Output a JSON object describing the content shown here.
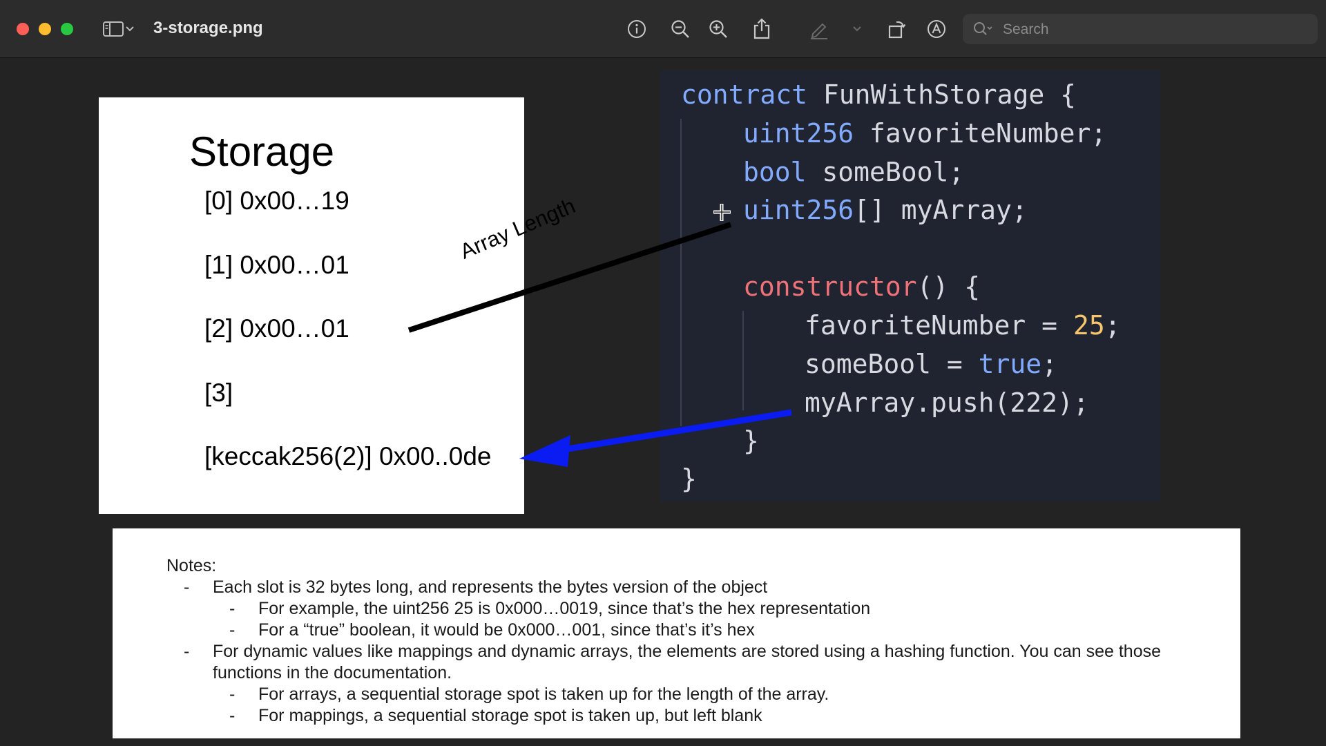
{
  "window": {
    "title": "3-storage.png",
    "search": {
      "placeholder": "Search",
      "value": ""
    },
    "toolbar_icons": [
      "sidebar-toggle-icon",
      "chevron-down-icon",
      "info-icon",
      "zoom-out-icon",
      "zoom-in-icon",
      "share-icon",
      "markup-pen-icon",
      "chevron-down-icon",
      "rotate-icon",
      "annotate-icon",
      "search-icon"
    ]
  },
  "storage": {
    "title": "Storage",
    "slots": [
      "[0] 0x00…19",
      "[1] 0x00…01",
      "[2] 0x00…01",
      "[3]",
      "[keccak256(2)] 0x00..0de"
    ]
  },
  "annotation": {
    "label": "Array Length",
    "arrow_black_color": "#000000",
    "arrow_blue_color": "#0a1cf2"
  },
  "code": {
    "contract_kw": "contract",
    "contract_name": " FunWithStorage {",
    "l2_type": "uint256",
    "l2_rest": " favoriteNumber;",
    "l3_type": "bool",
    "l3_rest": " someBool;",
    "l4_type": "uint256",
    "l4_rest": "[] myArray;",
    "ctor_kw": "constructor",
    "ctor_rest": "() {",
    "l6_lhs": "favoriteNumber = ",
    "l6_num": "25",
    "l6_end": ";",
    "l7_lhs": "someBool = ",
    "l7_bool": "true",
    "l7_end": ";",
    "l8": "myArray.push(222);",
    "close_inner": "}",
    "close_outer": "}",
    "colors": {
      "keyword": "#82aaff",
      "constructor": "#f07178",
      "number": "#f7c56b",
      "text": "#d7dae0",
      "background": "#1f2430"
    }
  },
  "notes": {
    "heading": "Notes:",
    "items": [
      {
        "bullet": "-",
        "text": "Each slot is 32 bytes long, and represents the bytes version of the object"
      },
      {
        "bullet": "-",
        "text": "For example, the uint256 25 is 0x000…0019, since that’s the hex representation"
      },
      {
        "bullet": "-",
        "text": "For a “true” boolean, it would be 0x000…001, since that’s it’s hex"
      },
      {
        "bullet": "-",
        "text": "For dynamic values like mappings and dynamic arrays, the elements are stored using a hashing function. You can see those"
      },
      {
        "bullet": "",
        "text": "functions in the documentation."
      },
      {
        "bullet": "-",
        "text": "For arrays, a sequential storage spot is taken up for the length of the array."
      },
      {
        "bullet": "-",
        "text": "For mappings, a sequential storage spot is taken up, but left blank"
      }
    ]
  }
}
